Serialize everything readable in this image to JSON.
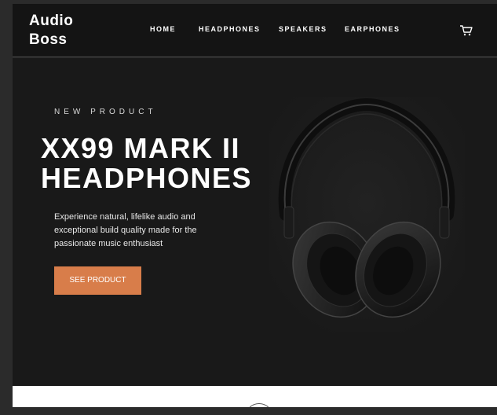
{
  "brand": {
    "line1": "Audio",
    "line2": "Boss"
  },
  "nav": {
    "items": [
      {
        "label": "HOME"
      },
      {
        "label": "HEADPHONES"
      },
      {
        "label": "SPEAKERS"
      },
      {
        "label": "EARPHONES"
      }
    ],
    "cart_icon": "cart-icon"
  },
  "hero": {
    "eyebrow": "NEW PRODUCT",
    "title_line1": "XX99 MARK II",
    "title_line2": "HEADPHONES",
    "description": "Experience natural, lifelike audio and exceptional build quality made for the passionate music enthusiast",
    "cta_label": "SEE PRODUCT",
    "image": "headphones-image"
  },
  "colors": {
    "background": "#191919",
    "header": "#141414",
    "accent": "#d87d4a",
    "text": "#ffffff"
  }
}
